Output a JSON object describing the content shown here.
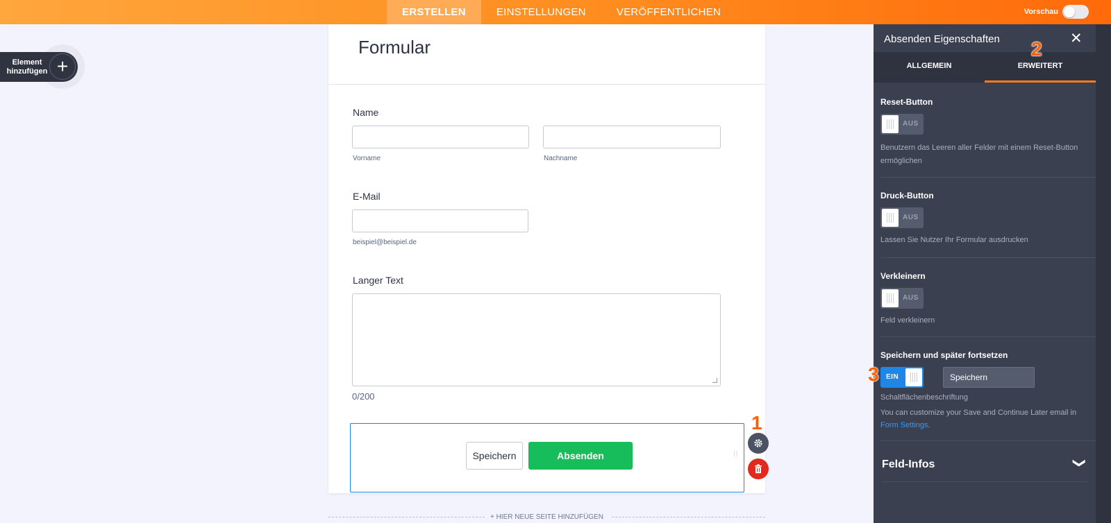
{
  "topbar": {
    "tabs": [
      {
        "label": "ERSTELLEN",
        "active": true
      },
      {
        "label": "EINSTELLUNGEN",
        "active": false
      },
      {
        "label": "VERÖFFENTLICHEN",
        "active": false
      }
    ],
    "preview_label": "Vorschau",
    "preview_on": false,
    "accent_color": "#ff8c1e"
  },
  "add_element": {
    "label_line1": "Element",
    "label_line2": "hinzufügen",
    "icon": "plus-icon"
  },
  "form": {
    "title": "Formular",
    "name_label": "Name",
    "first_name_sublabel": "Vorname",
    "last_name_sublabel": "Nachname",
    "email_label": "E-Mail",
    "email_sublabel": "beispiel@beispiel.de",
    "long_text_label": "Langer Text",
    "char_counter": "0/200",
    "save_button": "Speichern",
    "submit_button": "Absenden",
    "submit_color": "#18bd5b",
    "add_page": "+ HIER NEUE SEITE HINZUFÜGEN"
  },
  "annotations": {
    "one": "1",
    "two": "2",
    "three": "3"
  },
  "panel": {
    "title": "Absenden Eigenschaften",
    "tabs": [
      {
        "label": "ALLGEMEIN",
        "active": false
      },
      {
        "label": "ERWEITERT",
        "active": true
      }
    ],
    "reset": {
      "title": "Reset-Button",
      "toggle": "AUS",
      "desc": "Benutzern das Leeren aller Felder mit einem Reset-Button ermöglichen"
    },
    "print": {
      "title": "Druck-Button",
      "toggle": "AUS",
      "desc": "Lassen Sie Nutzer Ihr Formular ausdrucken"
    },
    "shrink": {
      "title": "Verkleinern",
      "toggle": "AUS",
      "desc": "Feld verkleinern"
    },
    "save_later": {
      "title": "Speichern und später fortsetzen",
      "toggle": "EIN",
      "button_text": "Speichern",
      "caption": "Schaltflächenbeschriftung",
      "note_text": "You can customize your Save and Continue Later email in",
      "note_link": "Form Settings",
      "note_end": "."
    },
    "field_info": "Feld-Infos"
  }
}
